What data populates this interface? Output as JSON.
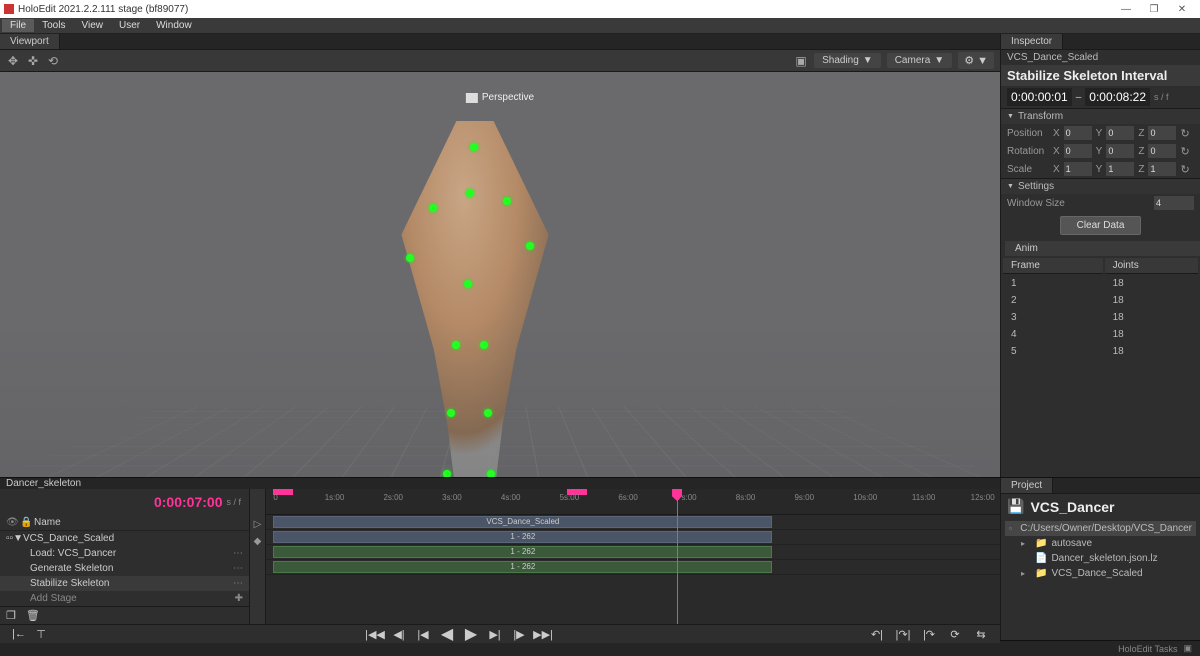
{
  "window": {
    "title": "HoloEdit 2021.2.2.111 stage (bf89077)",
    "btn_min": "—",
    "btn_max": "❐",
    "btn_close": "✕"
  },
  "menubar": [
    "File",
    "Tools",
    "View",
    "User",
    "Window"
  ],
  "viewport": {
    "tab": "Viewport",
    "persp": "Perspective",
    "shading": "Shading",
    "camera": "Camera"
  },
  "inspector": {
    "tab": "Inspector",
    "object": "VCS_Dance_Scaled",
    "title": "Stabilize Skeleton Interval",
    "time_start": "0:00:00:01",
    "time_end": "0:00:08:22",
    "time_sep": "–",
    "time_unit": "s / f",
    "transform_hdr": "Transform",
    "position": "Position",
    "rotation": "Rotation",
    "scale": "Scale",
    "x": "X",
    "y": "Y",
    "z": "Z",
    "pos_x": "0",
    "pos_y": "0",
    "pos_z": "0",
    "rot_x": "0",
    "rot_y": "0",
    "rot_z": "0",
    "scl_x": "1",
    "scl_y": "1",
    "scl_z": "1",
    "settings_hdr": "Settings",
    "window_size_lbl": "Window Size",
    "window_size_val": "4",
    "clear_btn": "Clear Data",
    "anim_tab": "Anim",
    "col_frame": "Frame",
    "col_joints": "Joints",
    "rows": [
      {
        "frame": "1",
        "joints": "18"
      },
      {
        "frame": "2",
        "joints": "18"
      },
      {
        "frame": "3",
        "joints": "18"
      },
      {
        "frame": "4",
        "joints": "18"
      },
      {
        "frame": "5",
        "joints": "18"
      }
    ]
  },
  "timeline": {
    "tab": "Dancer_skeleton",
    "timecode": "0:00:07:00",
    "timecode_unit": "s / f",
    "name_hdr": "Name",
    "tracks": {
      "root": "VCS_Dance_Scaled",
      "t1": "Load: VCS_Dancer",
      "t2": "Generate Skeleton",
      "t3": "Stabilize Skeleton",
      "add": "Add Stage"
    },
    "ruler_ticks": [
      "0",
      "1s:00",
      "2s:00",
      "3s:00",
      "4s:00",
      "5s:00",
      "6s:00",
      "7s:00",
      "8s:00",
      "9s:00",
      "10s:00",
      "11s:00",
      "12s:00"
    ],
    "clip_main": "VCS_Dance_Scaled",
    "clip_range": "1 - 262"
  },
  "project": {
    "tab": "Project",
    "name": "VCS_Dancer",
    "path": "C:/Users/Owner/Desktop/VCS_Dancer",
    "items": [
      "autosave",
      "Dancer_skeleton.json.lz",
      "VCS_Dance_Scaled"
    ]
  },
  "statusbar": {
    "tasks": "HoloEdit Tasks"
  }
}
